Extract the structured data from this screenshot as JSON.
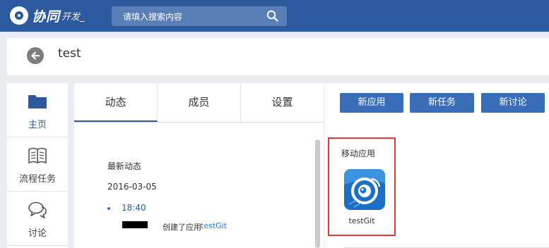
{
  "brand": {
    "name": "协同",
    "suffix": "开发_"
  },
  "search": {
    "placeholder": "请填入搜索内容"
  },
  "project": {
    "title": "test"
  },
  "nav": [
    {
      "label": "主页",
      "icon": "folder-icon",
      "active": true
    },
    {
      "label": "流程任务",
      "icon": "book-icon",
      "active": false
    },
    {
      "label": "讨论",
      "icon": "chat-icon",
      "active": false
    }
  ],
  "tabs": [
    {
      "label": "动态",
      "active": true
    },
    {
      "label": "成员",
      "active": false
    },
    {
      "label": "设置",
      "active": false
    }
  ],
  "activity": {
    "heading": "最新动态",
    "date": "2016-03-05",
    "entries": [
      {
        "time": "18:40",
        "action": "创建了应用",
        "target": "testGit"
      }
    ]
  },
  "actions": [
    {
      "label": "新应用"
    },
    {
      "label": "新任务"
    },
    {
      "label": "新讨论"
    }
  ],
  "apps": {
    "group_title": "移动应用",
    "items": [
      {
        "name": "testGit"
      }
    ]
  },
  "colors": {
    "topbar": "#2d5a9e",
    "button": "#3a6db7",
    "highlight": "#e3373a",
    "link": "#2d7ad6"
  }
}
